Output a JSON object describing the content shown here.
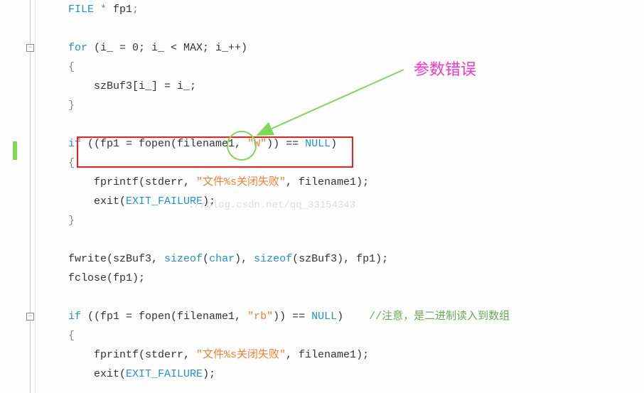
{
  "code": {
    "l1_type": "FILE",
    "l1_op": " * ",
    "l1_ident": "fp1",
    "l1_semi": ";",
    "l3_for": "for",
    "l3_text": " (i_ = 0; i_ < MAX; i_++)",
    "l4_brace": "{",
    "l5_text": "szBuf3[i_] = i_;",
    "l6_brace": "}",
    "l8_if": "if",
    "l8_pre": " ((fp1 = fopen(filename1, ",
    "l8_str": "\"W\"",
    "l8_mid": ")) == ",
    "l8_null": "NULL",
    "l8_end": ")",
    "l9_brace": "{",
    "l10_fn": "fprintf",
    "l10_pre": "(stderr, ",
    "l10_str": "\"文件%s关闭失败\"",
    "l10_post": ", filename1);",
    "l11_fn": "exit",
    "l11_pre": "(",
    "l11_macro": "EXIT_FAILURE",
    "l11_post": ");",
    "l12_brace": "}",
    "l14_fn": "fwrite",
    "l14_pre": "(szBuf3, ",
    "l14_sz1": "sizeof",
    "l14_mid1": "(",
    "l14_char": "char",
    "l14_mid2": "), ",
    "l14_sz2": "sizeof",
    "l14_post": "(szBuf3), fp1);",
    "l15_fn": "fclose",
    "l15_post": "(fp1);",
    "l17_if": "if",
    "l17_pre": " ((fp1 = fopen(filename1, ",
    "l17_str": "\"rb\"",
    "l17_mid": ")) == ",
    "l17_null": "NULL",
    "l17_end": ")    ",
    "l17_comment": "//注意，是二进制读入到数组",
    "l18_brace": "{",
    "l19_fn": "fprintf",
    "l19_pre": "(stderr, ",
    "l19_str": "\"文件%s关闭失败\"",
    "l19_post": ", filename1);",
    "l20_fn": "exit",
    "l20_pre": "(",
    "l20_macro": "EXIT_FAILURE",
    "l20_post": ");"
  },
  "annotation": {
    "label": "参数错误"
  },
  "watermark": "://blog.csdn.net/qq_33154343"
}
